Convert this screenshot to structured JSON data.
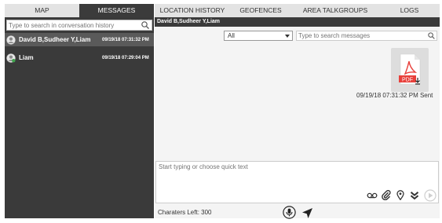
{
  "tabs_left": [
    {
      "label": "MAP",
      "active": false
    },
    {
      "label": "MESSAGES",
      "active": true
    }
  ],
  "tabs_right": [
    {
      "label": "LOCATION HISTORY"
    },
    {
      "label": "GEOFENCES"
    },
    {
      "label": "AREA TALKGROUPS"
    },
    {
      "label": "LOGS"
    }
  ],
  "sidebar": {
    "search_placeholder": "Type to search in conversation history",
    "conversations": [
      {
        "name": "David B,Sudheer Y,Liam",
        "time": "09/19/18 07:31:32 PM",
        "selected": true,
        "avatar": "group-avatar-icon"
      },
      {
        "name": "Liam",
        "time": "09/19/18 07:29:04 PM",
        "selected": false,
        "avatar": "user-avatar-icon"
      }
    ]
  },
  "chat": {
    "header_title": "David B,Sudheer Y,Liam",
    "filter_value": "All",
    "search_placeholder": "Type to search messages",
    "messages": [
      {
        "type": "attachment",
        "icon": "pdf-file-icon",
        "badge": "PDF",
        "meta": "09/19/18 07:31:32 PM Sent"
      }
    ],
    "compose_placeholder": "Start typing or choose quick text",
    "chars_left": "Charaters Left: 300"
  },
  "colors": {
    "dark_panel": "#3a3a3a",
    "selected_row": "#5a5a5a",
    "tab_bg": "#e3e3e3",
    "pdf_red": "#e8403b"
  }
}
